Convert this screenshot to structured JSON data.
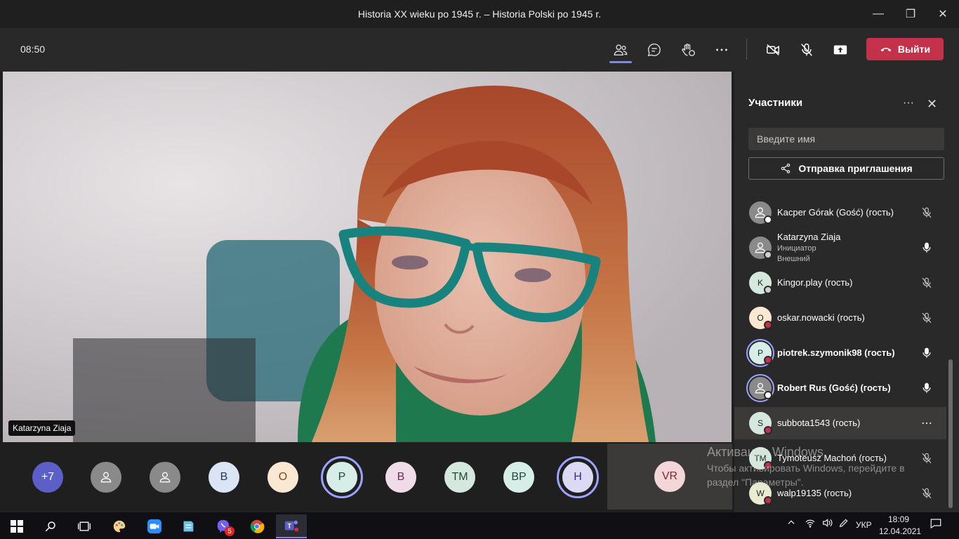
{
  "window": {
    "title": "Historia XX wieku po 1945 r. – Historia Polski po 1945 r.",
    "controls": {
      "minimize": "—",
      "restore": "❐",
      "close": "✕"
    }
  },
  "toolbar": {
    "time": "08:50",
    "leave_label": "Выйти",
    "icons": [
      "participants-icon",
      "chat-icon",
      "reactions-icon",
      "more-icon",
      "camera-off-icon",
      "mic-off-icon",
      "share-icon"
    ]
  },
  "main_video": {
    "name": "Katarzyna Ziaja"
  },
  "stripe": [
    {
      "initials": "+7",
      "bg": "#5b5fc7",
      "fg": "#ffffff",
      "ring": false
    },
    {
      "initials": "",
      "bg": "#8a8a8a",
      "fg": "#ffffff",
      "ring": false,
      "icon": "person-icon"
    },
    {
      "initials": "",
      "bg": "#8a8a8a",
      "fg": "#ffffff",
      "ring": false,
      "icon": "person-icon"
    },
    {
      "initials": "B",
      "bg": "#dbe4f5",
      "fg": "#243a5e",
      "ring": false
    },
    {
      "initials": "O",
      "bg": "#fbe8d2",
      "fg": "#7a4a12",
      "ring": false
    },
    {
      "initials": "P",
      "bg": "#d6ede8",
      "fg": "#1f4a3f",
      "ring": true
    },
    {
      "initials": "B",
      "bg": "#f0dbe8",
      "fg": "#6b2c4e",
      "ring": false
    },
    {
      "initials": "TM",
      "bg": "#d5e8dd",
      "fg": "#22483a",
      "ring": false
    },
    {
      "initials": "BP",
      "bg": "#d6ede8",
      "fg": "#1f4a3f",
      "ring": false
    },
    {
      "initials": "H",
      "bg": "#dcd9f4",
      "fg": "#3b2e7a",
      "ring": true
    }
  ],
  "vr_tile": {
    "initials": "VR",
    "bg": "#f3d6d8",
    "fg": "#7a2b33"
  },
  "panel": {
    "title": "Участники",
    "more": "···",
    "close": "✕",
    "search_placeholder": "Введите имя",
    "invite_label": "Отправка приглашения",
    "participants": [
      {
        "name": "Kacper Górak (Gość) (гость)",
        "initials": "",
        "bg": "#8a8a8a",
        "badge": "#ffffff",
        "mic": "muted",
        "bold": false
      },
      {
        "name": "Katarzyna Ziaja",
        "sub1": "Инициатор",
        "sub2": "Внешний",
        "initials": "",
        "bg": "#8a8a8a",
        "badge": "#cfcfcf",
        "mic": "on",
        "bold": false
      },
      {
        "name": "Kingor.play (гость)",
        "initials": "K",
        "bg": "#d5e8dd",
        "badge": "#cfcfcf",
        "mic": "muted",
        "bold": false
      },
      {
        "name": "oskar.nowacki (гость)",
        "initials": "O",
        "bg": "#fbe8d2",
        "badge": "#c4314b",
        "mic": "muted",
        "bold": false
      },
      {
        "name": "piotrek.szymonik98 (гость)",
        "initials": "P",
        "bg": "#d6ede8",
        "badge": "#c4314b",
        "mic": "on",
        "bold": true,
        "ring": true
      },
      {
        "name": "Robert Rus (Gość) (гость)",
        "initials": "",
        "bg": "#8a8a8a",
        "badge": "#ffffff",
        "mic": "on",
        "bold": true,
        "ring": true
      },
      {
        "name": "subbota1543 (гость)",
        "initials": "S",
        "bg": "#d5e8dd",
        "badge": "#c4314b",
        "mic": "more",
        "bold": false
      },
      {
        "name": "Tymoteusz Machoń (гость)",
        "initials": "TM",
        "bg": "#d5e8dd",
        "badge": "#c4314b",
        "mic": "muted",
        "bold": false
      },
      {
        "name": "walp19135 (гость)",
        "initials": "W",
        "bg": "#e8ecd0",
        "badge": "#c4314b",
        "mic": "muted",
        "bold": false
      }
    ]
  },
  "watermark": {
    "line1": "Активация Windows",
    "line2": "Чтобы активировать Windows, перейдите в раздел \"Параметры\"."
  },
  "taskbar": {
    "lang": "УКР",
    "time": "18:09",
    "date": "12.04.2021",
    "viber_badge": "5"
  }
}
